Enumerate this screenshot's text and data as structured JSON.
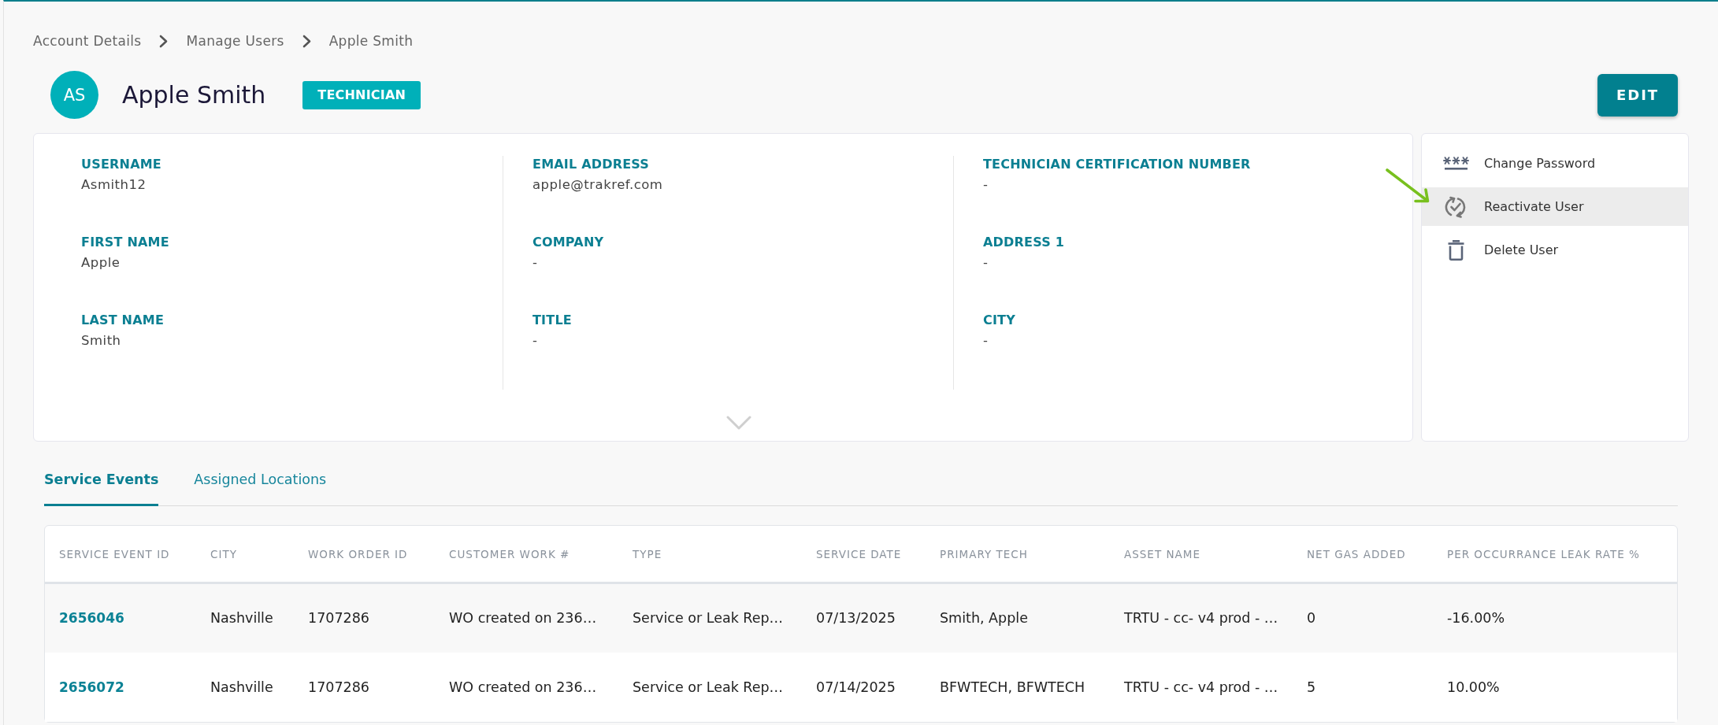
{
  "breadcrumb": [
    {
      "label": "Account Details"
    },
    {
      "label": "Manage Users"
    },
    {
      "label": "Apple Smith"
    }
  ],
  "user": {
    "initials": "AS",
    "name": "Apple Smith",
    "role": "TECHNICIAN"
  },
  "edit_button": {
    "label": "EDIT"
  },
  "details": {
    "expanded": false,
    "columns": [
      {
        "fields": [
          {
            "label": "USERNAME",
            "value": "Asmith12"
          },
          {
            "label": "FIRST NAME",
            "value": "Apple"
          },
          {
            "label": "LAST NAME",
            "value": "Smith"
          }
        ]
      },
      {
        "fields": [
          {
            "label": "EMAIL ADDRESS",
            "value": "apple@trakref.com"
          },
          {
            "label": "COMPANY",
            "value": "-"
          },
          {
            "label": "TITLE",
            "value": "-"
          }
        ]
      },
      {
        "fields": [
          {
            "label": "TECHNICIAN CERTIFICATION NUMBER",
            "value": "-"
          },
          {
            "label": "ADDRESS 1",
            "value": "-"
          },
          {
            "label": "CITY",
            "value": "-"
          }
        ]
      }
    ]
  },
  "actions": [
    {
      "label": "Change Password",
      "kind": "password",
      "highlighted": false
    },
    {
      "label": "Reactivate User",
      "kind": "reactivate",
      "highlighted": true
    },
    {
      "label": "Delete User",
      "kind": "delete",
      "highlighted": false
    }
  ],
  "tabs": [
    {
      "label": "Service Events",
      "selected": true
    },
    {
      "label": "Assigned Locations",
      "selected": false
    }
  ],
  "table": {
    "columns": [
      {
        "label": "SERVICE EVENT ID",
        "kind": "link"
      },
      {
        "label": "CITY",
        "kind": "text"
      },
      {
        "label": "WORK ORDER ID",
        "kind": "text"
      },
      {
        "label": "CUSTOMER WORK #",
        "kind": "text"
      },
      {
        "label": "TYPE",
        "kind": "text"
      },
      {
        "label": "SERVICE DATE",
        "kind": "text"
      },
      {
        "label": "PRIMARY TECH",
        "kind": "text"
      },
      {
        "label": "ASSET NAME",
        "kind": "text"
      },
      {
        "label": "NET GAS ADDED",
        "kind": "text"
      },
      {
        "label": "PER OCCURRANCE LEAK RATE %",
        "kind": "text"
      }
    ],
    "rows": [
      {
        "cells": [
          "2656046",
          "Nashville",
          "1707286",
          "WO created on 236…",
          "Service or Leak Rep…",
          "07/13/2025",
          "Smith, Apple",
          "TRTU - cc- v4 prod - …",
          "0",
          "-16.00%"
        ]
      },
      {
        "cells": [
          "2656072",
          "Nashville",
          "1707286",
          "WO created on 236…",
          "Service or Leak Rep…",
          "07/14/2025",
          "BFWTECH, BFWTECH",
          "TRTU - cc- v4 prod - …",
          "5",
          "10.00%"
        ]
      }
    ]
  }
}
